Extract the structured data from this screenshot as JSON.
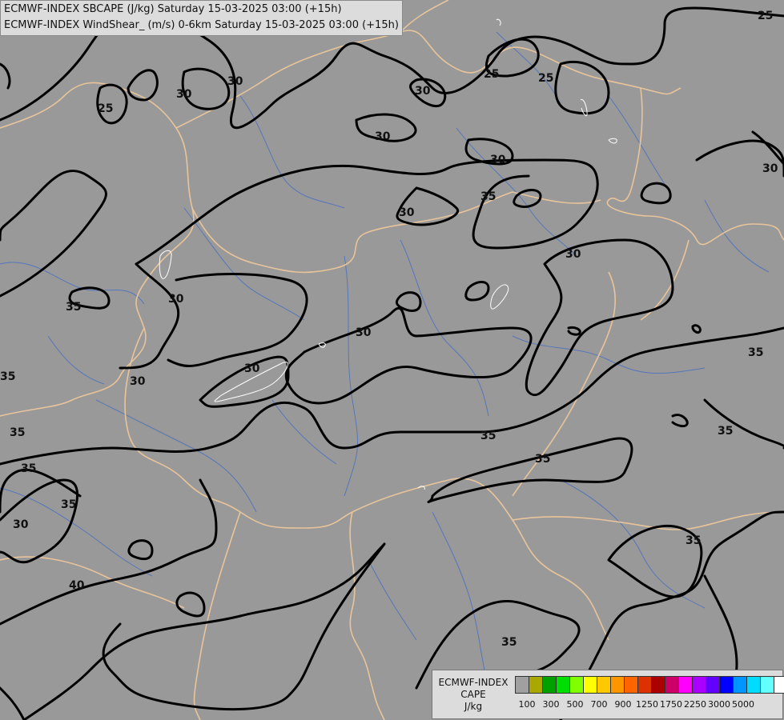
{
  "title": {
    "line1": "ECMWF-INDEX SBCAPE (J/kg) Saturday 15-03-2025 03:00 (+15h)",
    "line2": "ECMWF-INDEX WindShear_ (m/s) 0-6km Saturday 15-03-2025 03:00 (+15h)"
  },
  "legend": {
    "line1": "ECMWF-INDEX",
    "line2": "CAPE",
    "line3": "J/kg",
    "colors": [
      "#a0a0a0",
      "#a8a800",
      "#00a000",
      "#00dd00",
      "#80ff00",
      "#ffff00",
      "#ffc800",
      "#ff9600",
      "#ff6400",
      "#dd3200",
      "#aa0000",
      "#cc0066",
      "#ff00ff",
      "#aa00ff",
      "#6400ff",
      "#0000ff",
      "#0096ff",
      "#00dcff",
      "#64ffff",
      "#ffffff"
    ],
    "ticks": [
      "100",
      "300",
      "500",
      "700",
      "900",
      "1250",
      "1750",
      "2250",
      "3000",
      "5000"
    ]
  },
  "map_data": {
    "background_color": "#999999",
    "border_color": "#e8c49a",
    "river_color": "#4a70c0",
    "contour_color": "#000000",
    "contour_labels": [
      "25",
      "25",
      "25",
      "25",
      "30",
      "30",
      "30",
      "30",
      "30",
      "30",
      "30",
      "30",
      "30",
      "30",
      "30",
      "30",
      "30",
      "35",
      "35",
      "35",
      "35",
      "35",
      "35",
      "35",
      "35",
      "35",
      "35",
      "35",
      "35",
      "40"
    ]
  }
}
